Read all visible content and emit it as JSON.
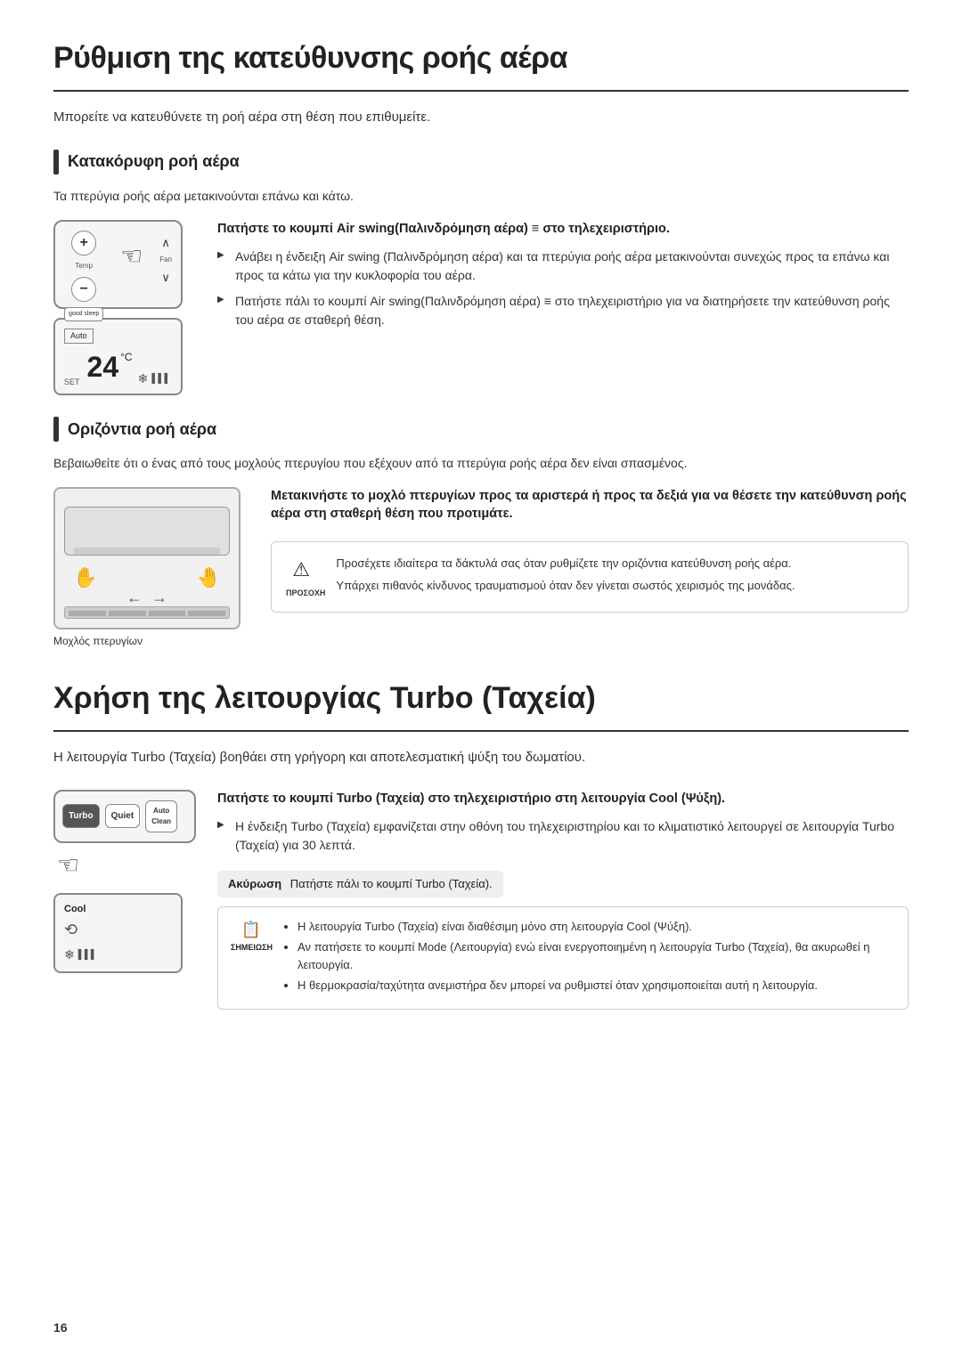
{
  "page": {
    "number": "16",
    "title": "Ρύθμιση της κατεύθυνσης ροής αέρα",
    "subtitle": "Μπορείτε να κατευθύνετε τη ροή αέρα στη θέση που επιθυμείτε.",
    "section1": {
      "title": "Κατακόρυφη ροή αέρα",
      "desc": "Τα πτερύγια ροής αέρα μετακινούνται επάνω και κάτω.",
      "instr_title": "Πατήστε το κουμπί Air swing(Παλινδρόμηση αέρα) ≡ στο τηλεχειριστήριο.",
      "bullets": [
        "Ανάβει η ένδειξη Air swing (Παλινδρόμηση αέρα) και τα πτερύγια ροής αέρα μετακινούνται συνεχώς προς τα επάνω και προς τα κάτω για την κυκλοφορία του αέρα.",
        "Πατήστε πάλι το κουμπί Air swing(Παλινδρόμηση αέρα) ≡ στο τηλεχειριστήριο για να διατηρήσετε την κατεύθυνση ροής του αέρα σε σταθερή θέση."
      ],
      "remote": {
        "temp_label": "Temp",
        "fan_label": "Fan",
        "good_sleep": "good sleep",
        "auto_label": "Auto",
        "set_label": "SET",
        "temp_value": "24",
        "temp_unit": "°C"
      }
    },
    "section2": {
      "title": "Οριζόντια ροή αέρα",
      "desc": "Βεβαιωθείτε ότι ο ένας από τους μοχλούς πτερυγίου που εξέχουν από τα πτερύγια ροής αέρα δεν είναι σπασμένος.",
      "instr_title": "Μετακινήστε το μοχλό πτερυγίων προς τα αριστερά ή προς τα δεξιά για να θέσετε την κατεύθυνση ροής αέρα στη σταθερή θέση που προτιμάτε.",
      "caption": "Μοχλός πτερυγίων",
      "warning": {
        "label": "ΠΡΟΣΟΧΗ",
        "text1": "Προσέχετε ιδιαίτερα τα δάκτυλά σας όταν ρυθμίζετε την οριζόντια κατεύθυνση ροής αέρα.",
        "text2": "Υπάρχει πιθανός κίνδυνος τραυματισμού όταν δεν γίνεται σωστός χειρισμός της μονάδας."
      }
    },
    "section3": {
      "title": "Χρήση της λειτουργίας Turbo (Ταχεία)",
      "subtitle": "Η λειτουργία Turbo (Ταχεία) βοηθάει στη γρήγορη και αποτελεσματική ψύξη του δωματίου.",
      "instr_title": "Πατήστε το κουμπί Turbo (Ταχεία) στο τηλεχειριστήριο στη λειτουργία Cool (Ψύξη).",
      "bullets": [
        "Η ένδειξη Turbo (Ταχεία) εμφανίζεται στην οθόνη του τηλεχειριστηρίου και το κλιματιστικό λειτουργεί σε λειτουργία Turbo (Ταχεία) για 30 λεπτά."
      ],
      "cancel": {
        "label": "Ακύρωση",
        "text": "Πατήστε πάλι το κουμπί Turbo (Ταχεία)."
      },
      "remote": {
        "turbo_label": "Turbo",
        "quiet_label": "Quiet",
        "auto_clean_label": "Auto Clean",
        "cool_label": "Cool"
      },
      "note": {
        "label": "ΣΗΜΕΙΩΣΗ",
        "bullets": [
          "Η λειτουργία Turbo (Ταχεία) είναι διαθέσιμη μόνο στη λειτουργία Cool (Ψύξη).",
          "Αν πατήσετε το κουμπί Mode (Λειτουργία) ενώ είναι ενεργοποιημένη η λειτουργία Turbo (Ταχεία), θα ακυρωθεί η λειτουργία.",
          "Η θερμοκρασία/ταχύτητα ανεμιστήρα δεν μπορεί να ρυθμιστεί όταν χρησιμοποιείται αυτή η λειτουργία."
        ]
      }
    }
  }
}
